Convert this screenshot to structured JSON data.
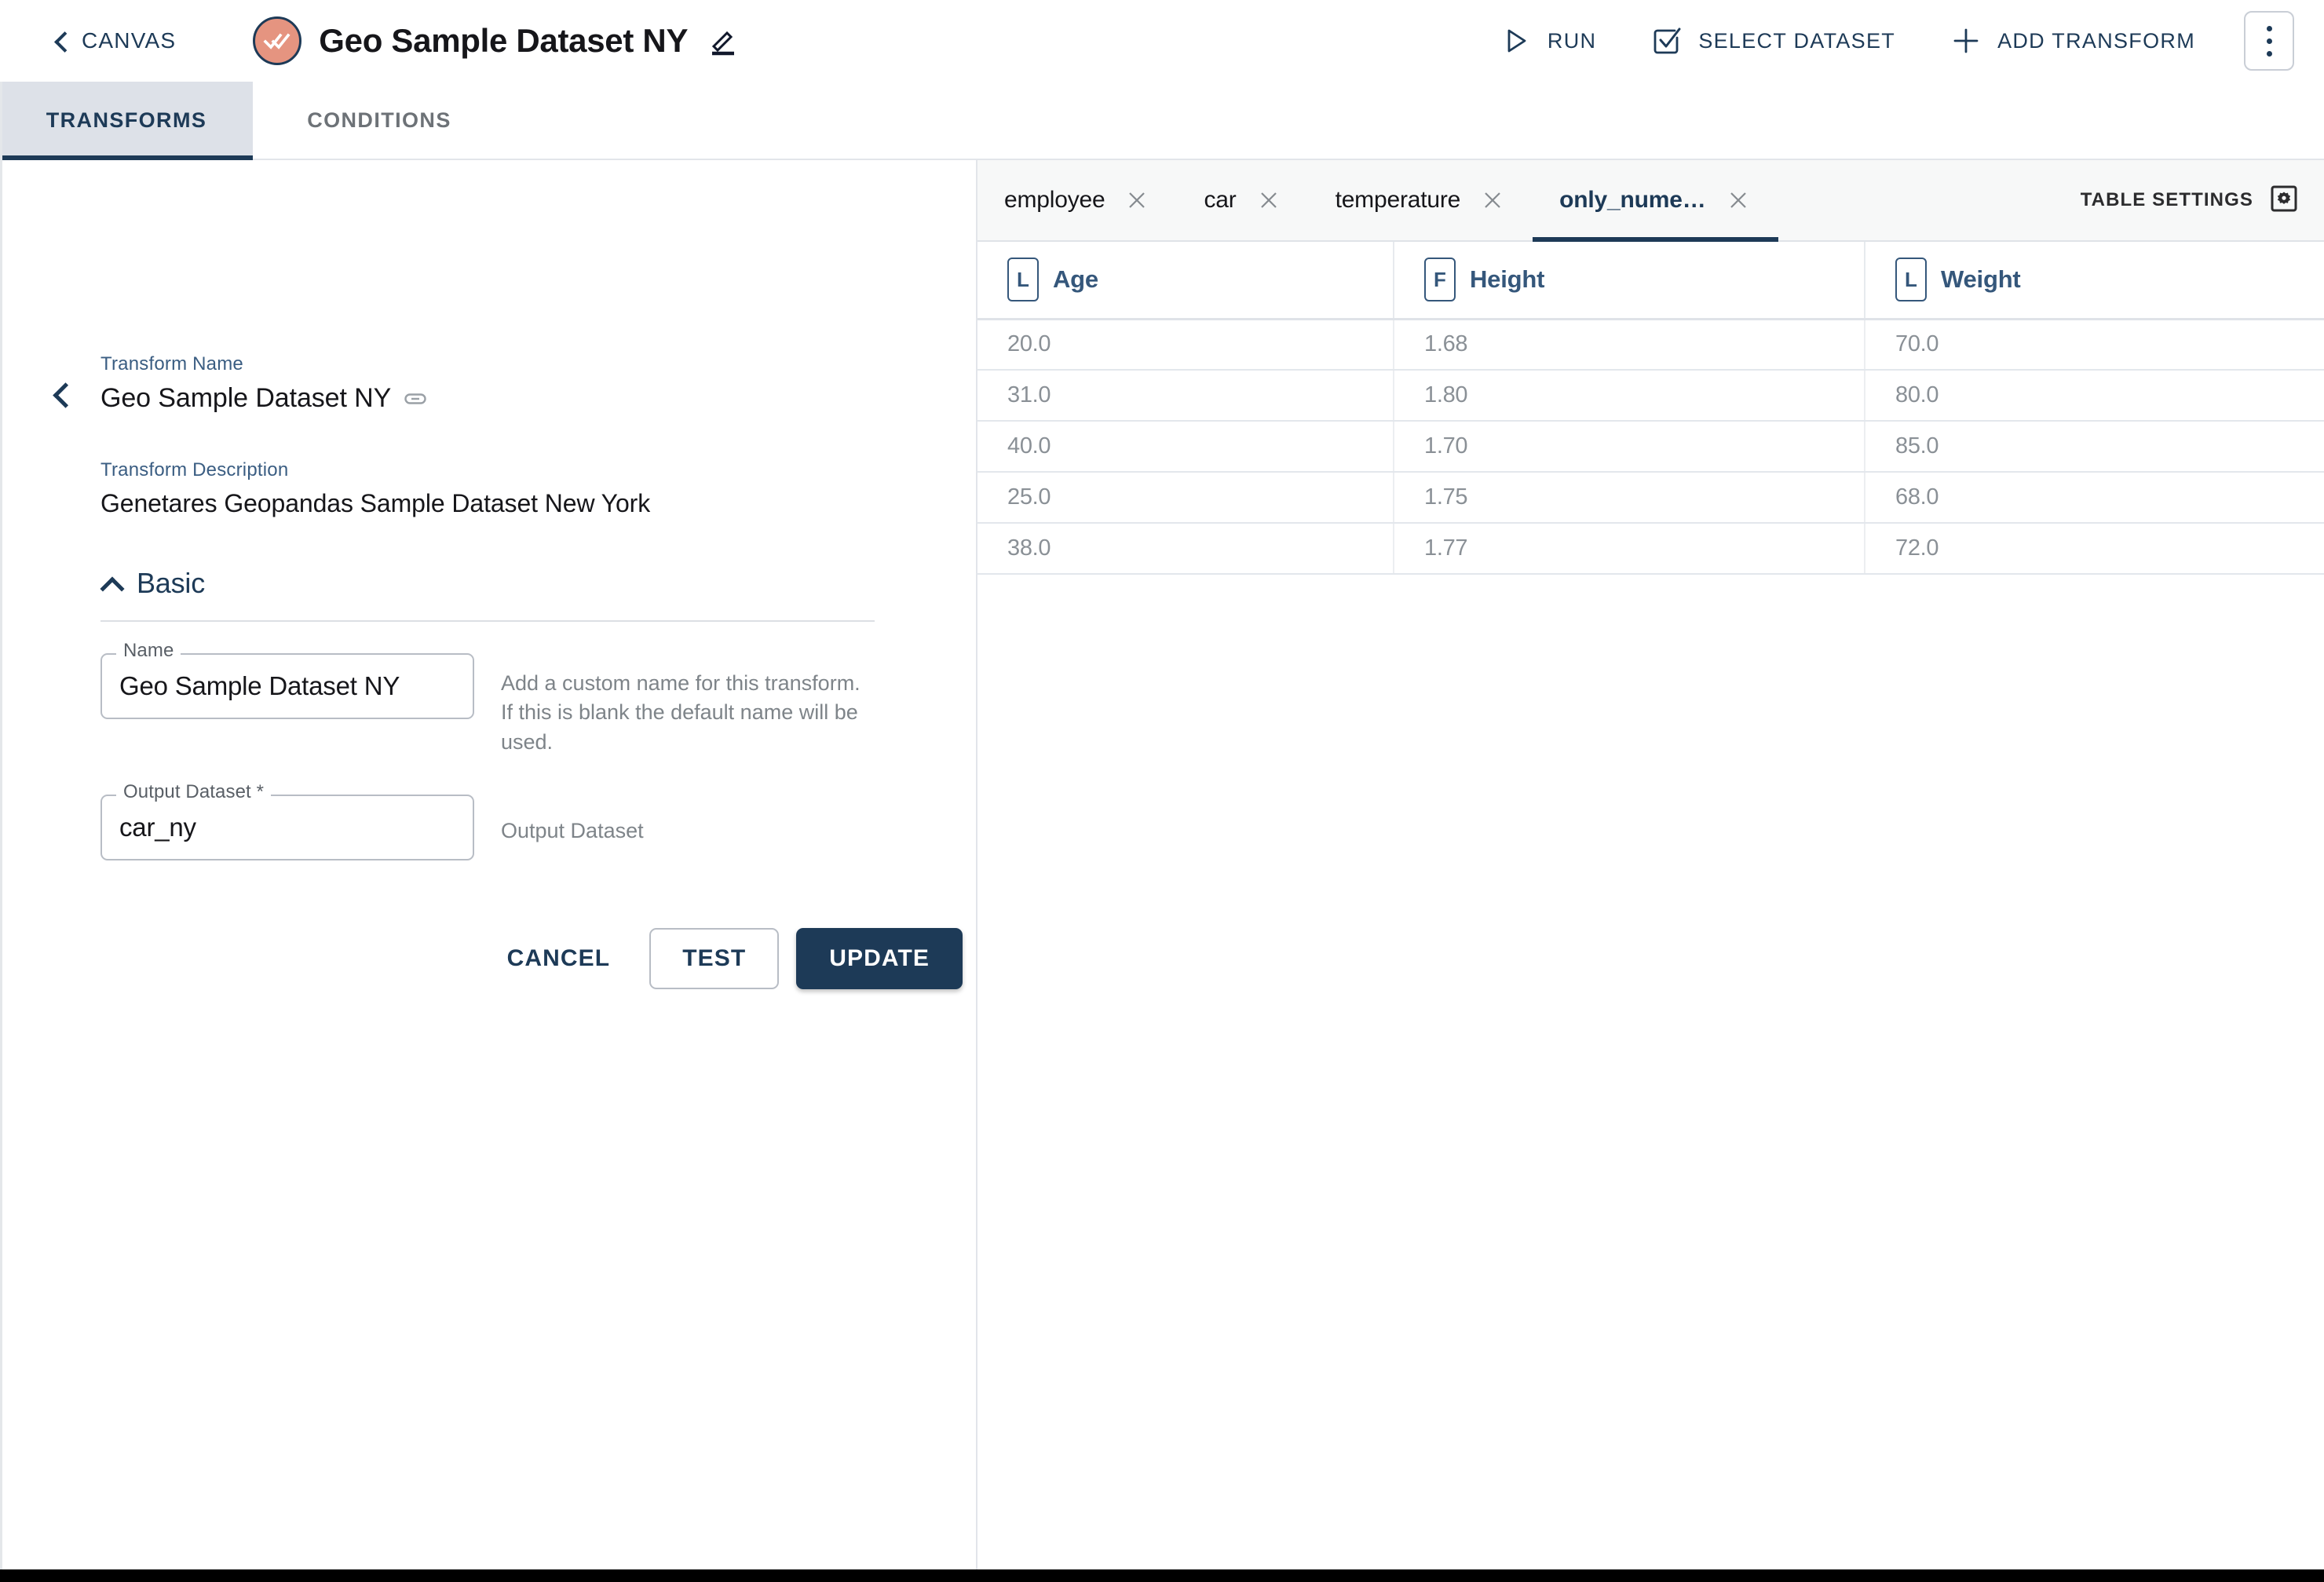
{
  "header": {
    "back_label": "CANVAS",
    "back_icon": "chevron-left-icon",
    "avatar_icon": "double-check-icon",
    "title": "Geo Sample Dataset NY",
    "edit_icon": "pencil-edit-icon",
    "actions": [
      {
        "label": "RUN",
        "icon": "play-icon"
      },
      {
        "label": "SELECT DATASET",
        "icon": "check-square-icon"
      },
      {
        "label": "ADD TRANSFORM",
        "icon": "plus-icon"
      }
    ],
    "overflow_icon": "kebab-menu-icon"
  },
  "main_tabs": [
    {
      "label": "TRANSFORMS",
      "active": true
    },
    {
      "label": "CONDITIONS",
      "active": false
    }
  ],
  "left_panel": {
    "collapse_icon": "chevron-left-icon",
    "transform_name_label": "Transform Name",
    "transform_name_value": "Geo Sample Dataset NY",
    "link_icon": "link-icon",
    "transform_description_label": "Transform Description",
    "transform_description_value": "Genetares Geopandas Sample Dataset New York",
    "section": {
      "title": "Basic",
      "caret_icon": "chevron-up-icon",
      "expanded": true
    },
    "fields": [
      {
        "label": "Name",
        "value": "Geo Sample Dataset NY",
        "placeholder": "",
        "helper": "Add a custom name for this transform. If this is blank the default name will be used."
      },
      {
        "label": "Output Dataset *",
        "value": "car_ny",
        "placeholder": "",
        "helper": "Output Dataset"
      }
    ],
    "buttons": {
      "cancel": "CANCEL",
      "test": "TEST",
      "update": "UPDATE"
    }
  },
  "right_panel": {
    "dataset_tabs": [
      {
        "label": "employee",
        "active": false,
        "close_icon": "close-icon"
      },
      {
        "label": "car",
        "active": false,
        "close_icon": "close-icon"
      },
      {
        "label": "temperature",
        "active": false,
        "close_icon": "close-icon"
      },
      {
        "label": "only_nume…",
        "active": true,
        "close_icon": "close-icon"
      }
    ],
    "table_settings_label": "TABLE SETTINGS",
    "table_settings_icon": "gear-icon",
    "table": {
      "columns": [
        {
          "name": "Age",
          "type_badge": "L"
        },
        {
          "name": "Height",
          "type_badge": "F"
        },
        {
          "name": "Weight",
          "type_badge": "L"
        }
      ],
      "rows": [
        [
          "20.0",
          "1.68",
          "70.0"
        ],
        [
          "31.0",
          "1.80",
          "80.0"
        ],
        [
          "40.0",
          "1.70",
          "85.0"
        ],
        [
          "25.0",
          "1.75",
          "68.0"
        ],
        [
          "38.0",
          "1.77",
          "72.0"
        ]
      ]
    }
  },
  "colors": {
    "accent_navy": "#1d3a57",
    "avatar_salmon": "#e59480",
    "tab_active_bg": "#dde1e8",
    "column_header_text": "#35577b",
    "muted_text": "#8a9096"
  }
}
